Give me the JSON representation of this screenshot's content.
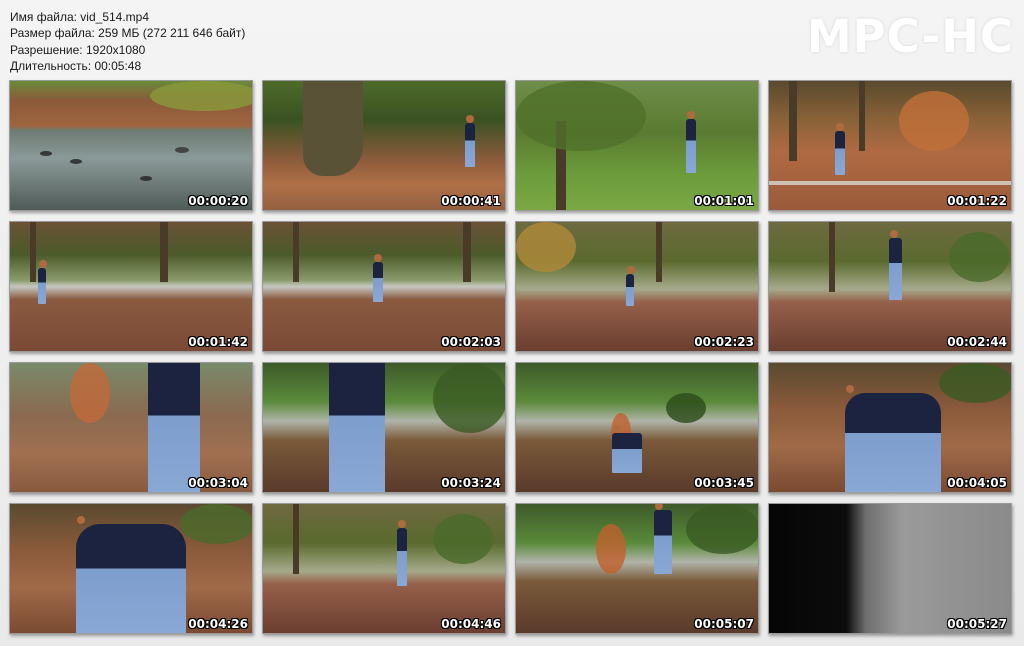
{
  "info": {
    "filename": "Имя файла: vid_514.mp4",
    "filesize": "Размер файла: 259 МБ (272 211 646 байт)",
    "resolution": "Разрешение: 1920x1080",
    "duration": "Длительность: 00:05:48"
  },
  "logo": "MPC-HC",
  "thumbnails": [
    {
      "time": "00:00:20"
    },
    {
      "time": "00:00:41"
    },
    {
      "time": "00:01:01"
    },
    {
      "time": "00:01:22"
    },
    {
      "time": "00:01:42"
    },
    {
      "time": "00:02:03"
    },
    {
      "time": "00:02:23"
    },
    {
      "time": "00:02:44"
    },
    {
      "time": "00:03:04"
    },
    {
      "time": "00:03:24"
    },
    {
      "time": "00:03:45"
    },
    {
      "time": "00:04:05"
    },
    {
      "time": "00:04:26"
    },
    {
      "time": "00:04:46"
    },
    {
      "time": "00:05:07"
    },
    {
      "time": "00:05:27"
    }
  ]
}
